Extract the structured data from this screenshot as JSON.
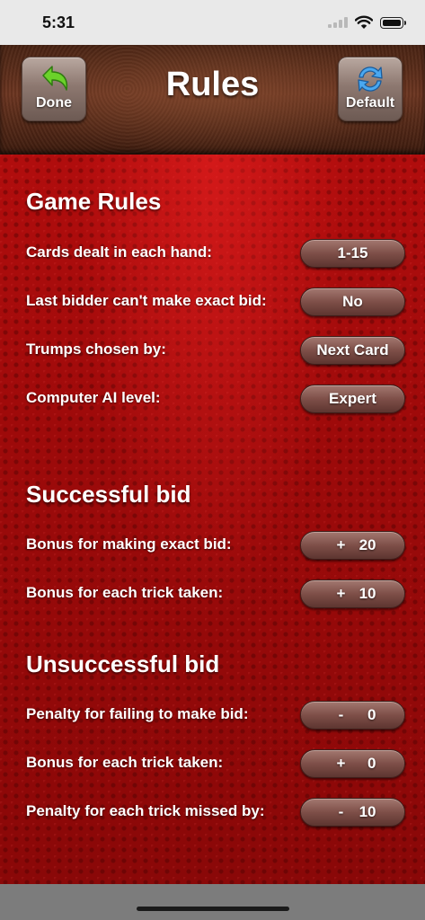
{
  "status_bar": {
    "time": "5:31"
  },
  "header": {
    "title": "Rules",
    "done_label": "Done",
    "default_label": "Default"
  },
  "game_rules": {
    "title": "Game Rules",
    "rows": [
      {
        "label": "Cards dealt in each hand:",
        "value": "1-15"
      },
      {
        "label": "Last bidder can't make exact bid:",
        "value": "No"
      },
      {
        "label": "Trumps chosen by:",
        "value": "Next Card"
      },
      {
        "label": "Computer AI level:",
        "value": "Expert"
      }
    ]
  },
  "successful_bid": {
    "title": "Successful bid",
    "rows": [
      {
        "label": "Bonus for making exact bid:",
        "sign": "+",
        "value": "20"
      },
      {
        "label": "Bonus for each trick taken:",
        "sign": "+",
        "value": "10"
      }
    ]
  },
  "unsuccessful_bid": {
    "title": "Unsuccessful bid",
    "rows": [
      {
        "label": "Penalty for failing to make bid:",
        "sign": "-",
        "value": "0"
      },
      {
        "label": "Bonus for each trick taken:",
        "sign": "+",
        "value": "0"
      },
      {
        "label": "Penalty for each trick missed by:",
        "sign": "-",
        "value": "10"
      }
    ]
  },
  "icons": {
    "done": "back-arrow-icon",
    "default": "refresh-icon"
  }
}
